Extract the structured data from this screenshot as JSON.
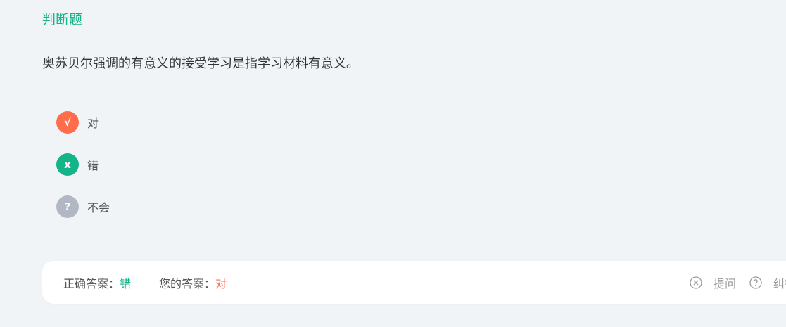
{
  "question": {
    "type_label": "判断题",
    "text": "奥苏贝尔强调的有意义的接受学习是指学习材料有意义。"
  },
  "options": [
    {
      "symbol": "√",
      "label": "对",
      "color": "#ff6d4d"
    },
    {
      "symbol": "x",
      "label": "错",
      "color": "#15b38a"
    },
    {
      "symbol": "?",
      "label": "不会",
      "color": "#b1b8c4"
    }
  ],
  "answer_bar": {
    "correct_label": "正确答案：",
    "correct_value": "错",
    "correct_color": "#15b38a",
    "yours_label": "您的答案：",
    "yours_value": "对",
    "yours_color": "#ff6d4d",
    "ask_label": "提问",
    "report_label": "纠错"
  }
}
